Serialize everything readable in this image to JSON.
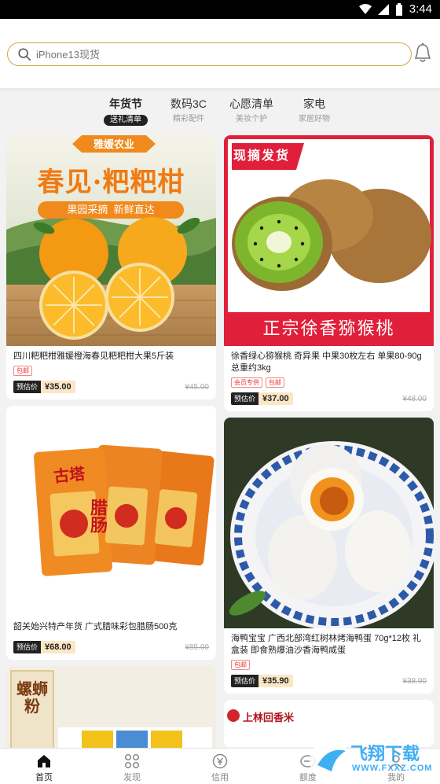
{
  "status": {
    "time": "3:44",
    "battery": "2"
  },
  "search": {
    "placeholder": "iPhone13现货"
  },
  "tabs": [
    {
      "title": "年货节",
      "sub": "送礼清单",
      "active": true
    },
    {
      "title": "数码3C",
      "sub": "精彩配件",
      "active": false
    },
    {
      "title": "心愿清单",
      "sub": "美妆个护",
      "active": false
    },
    {
      "title": "家电",
      "sub": "家居好物",
      "active": false
    }
  ],
  "products": {
    "p1": {
      "banner_brand": "雅媛农业",
      "banner_title": "春见·粑粑柑",
      "banner_sub": "果园采摘  新鲜直达",
      "title": "四川粑粑柑雅媛橙海春见粑粑柑大果5斤装",
      "badges": [
        "包邮"
      ],
      "price_tag": "预估价",
      "price": "¥35.00",
      "old_price": "¥45.00"
    },
    "p2": {
      "banner_tag": "现摘发货",
      "banner_title": "正宗徐香猕猴桃",
      "title": "徐香绿心猕猴桃 奇异果 中果30枚左右 单果80-90g 总重约3kg",
      "badges": [
        "会员专供",
        "包邮"
      ],
      "price_tag": "预估价",
      "price": "¥37.00",
      "old_price": "¥48.00"
    },
    "p3": {
      "pack_brand": "古塔",
      "pack_name": "腊肠",
      "title": "韶关始兴特产年货 广式腊味彩包腊肠500克",
      "badges": [],
      "price_tag": "预估价",
      "price": "¥68.00",
      "old_price": "¥85.00"
    },
    "p4": {
      "title": "海鸭宝宝 广西北部湾红树林烤海鸭蛋 70g*12枚 礼盒装 即食熟爆油沙香海鸭咸蛋",
      "badges": [
        "包邮"
      ],
      "price_tag": "预估价",
      "price": "¥35.90",
      "old_price": "¥38.90"
    },
    "p5": {
      "pack_text": "螺蛳粉"
    },
    "p6": {
      "brand": "上林回香米"
    }
  },
  "nav": [
    {
      "label": "首页",
      "icon": "home-icon",
      "active": true
    },
    {
      "label": "发现",
      "icon": "discover-icon",
      "active": false
    },
    {
      "label": "信用",
      "icon": "credit-icon",
      "active": false
    },
    {
      "label": "额度",
      "icon": "quota-icon",
      "active": false
    },
    {
      "label": "我的",
      "icon": "profile-icon",
      "active": false
    }
  ],
  "watermark": {
    "title": "飞翔下载",
    "url": "WWW.FXXZ.COM"
  },
  "colors": {
    "accent": "#d4a64a",
    "badge": "#e33333",
    "kiwi_red": "#e0203a"
  }
}
